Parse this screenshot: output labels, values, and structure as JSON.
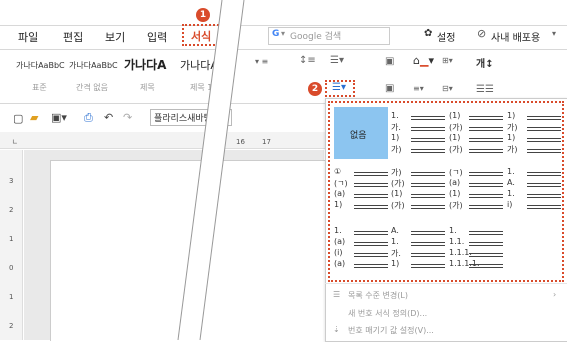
{
  "menu": {
    "file": "파일",
    "edit": "편집",
    "view": "보기",
    "input": "입력",
    "format": "서식"
  },
  "search": {
    "engine": "G",
    "placeholder": "Google 검색"
  },
  "right": {
    "settings": "설정",
    "share": "사내 배포용"
  },
  "styles": {
    "preview1": "가나다AaBbC",
    "sub1": "표준",
    "preview2": "가나다AaBbC",
    "sub2": "간격 없음",
    "preview3": "가나다A",
    "sub3": "제목",
    "preview4": "가나다Aa",
    "sub4": "제목 1"
  },
  "font_name": "플라리스새바탕",
  "ruler": {
    "n16": "16",
    "n17": "17"
  },
  "vruler": [
    "3",
    "2",
    "1",
    "0",
    "1",
    "2"
  ],
  "markers": {
    "one": "1",
    "two": "2"
  },
  "list_none": "없음",
  "lists": [
    [
      "1.",
      "가.",
      "1)",
      "가)"
    ],
    [
      "(1)",
      "(가)",
      "(1)",
      "(가)"
    ],
    [
      "1)",
      "가)",
      "1)",
      "가)"
    ],
    [
      "①",
      "(ㄱ)",
      "(a)",
      "1)"
    ],
    [
      "가)",
      "(가)",
      "(1)",
      "(가)"
    ],
    [
      "(ㄱ)",
      "(a)",
      "(1)",
      "(가)"
    ],
    [
      "1.",
      "A.",
      "1.",
      "i)"
    ],
    [
      "1.",
      "(a)",
      "(i)",
      "(a)"
    ],
    [
      "A.",
      "1.",
      "가.",
      "1)"
    ],
    [
      "1.",
      "1.1.",
      "1.1.1.",
      "1.1.1.1."
    ]
  ],
  "ctx": {
    "level": "목록 수준 변경(L)",
    "new_format": "새 번호 서식 정의(D)...",
    "numbering": "번호 매기기 값 설정(V)..."
  },
  "colors": {
    "accent": "#d94b2b",
    "selected": "#8cc5f0"
  }
}
